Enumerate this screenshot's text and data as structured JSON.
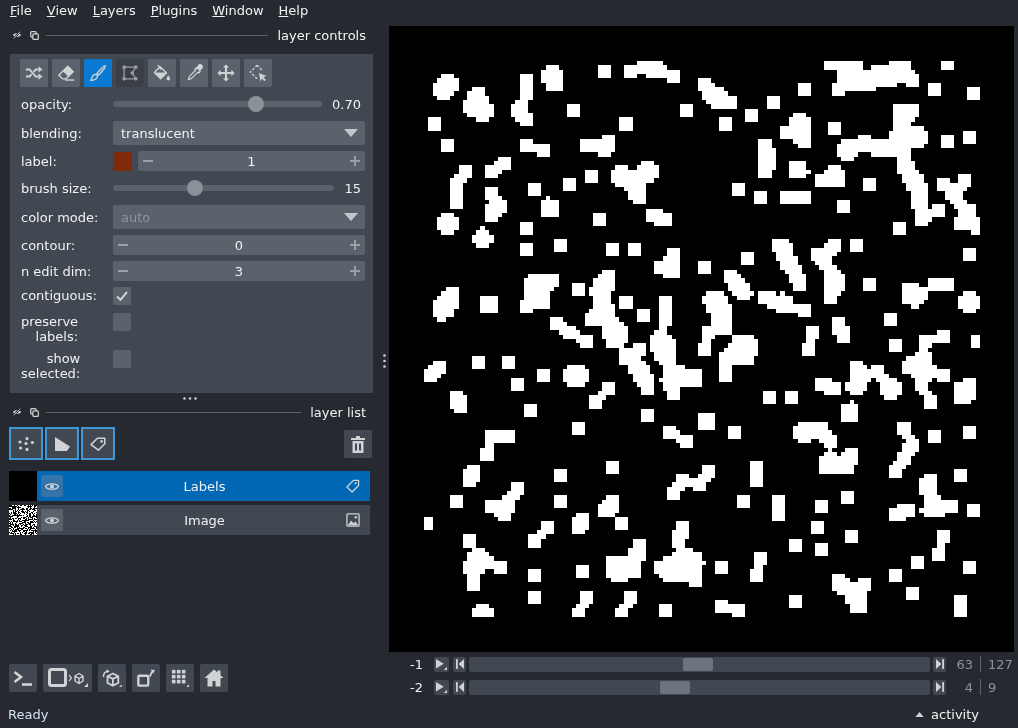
{
  "menu_bar": [
    "File",
    "View",
    "Layers",
    "Plugins",
    "Window",
    "Help"
  ],
  "layer_controls": {
    "title": "layer controls",
    "tools": [
      {
        "kind": "shuffle",
        "selected": false,
        "disabled": false
      },
      {
        "kind": "erase",
        "selected": false,
        "disabled": false
      },
      {
        "kind": "paint",
        "selected": true,
        "disabled": false
      },
      {
        "kind": "polygon",
        "selected": false,
        "disabled": true
      },
      {
        "kind": "fill",
        "selected": false,
        "disabled": false
      },
      {
        "kind": "picker",
        "selected": false,
        "disabled": false
      },
      {
        "kind": "pan_zoom",
        "selected": false,
        "disabled": false
      },
      {
        "kind": "transform",
        "selected": false,
        "disabled": false
      }
    ],
    "rows": [
      {
        "kind": "slider",
        "label": "opacity:",
        "level": 0.7,
        "reading": "0.70"
      },
      {
        "kind": "dropdown",
        "label": "blending:",
        "value": "translucent",
        "disabled": false
      },
      {
        "kind": "spinbox",
        "label": "label:",
        "value": "1",
        "color": "#7f2a0a"
      },
      {
        "kind": "slider",
        "label": "brush size:",
        "level": 0.36,
        "reading": "15"
      },
      {
        "kind": "dropdown",
        "label": "color mode:",
        "value": "auto",
        "disabled": true
      },
      {
        "kind": "spinbox",
        "label": "contour:",
        "value": "0"
      },
      {
        "kind": "spinbox",
        "label": "n edit dim:",
        "value": "3"
      },
      {
        "kind": "checkbox",
        "label": "contiguous:",
        "checked": true
      },
      {
        "kind": "checkbox",
        "label": "preserve labels:",
        "checked": false
      },
      {
        "kind": "checkbox",
        "label": "show selected:",
        "checked": false
      }
    ]
  },
  "layer_list": {
    "title": "layer list",
    "layers": [
      {
        "kind": "labels",
        "name": "Labels",
        "selected": true,
        "visible": true
      },
      {
        "kind": "image",
        "name": "Image",
        "selected": false,
        "visible": true
      }
    ]
  },
  "dims": [
    {
      "label": "-1",
      "level": 0.496,
      "current": "63",
      "total": "127"
    },
    {
      "label": "-2",
      "level": 0.444,
      "current": "4",
      "total": "9"
    }
  ],
  "status_bar": {
    "message": "Ready",
    "activity": "activity"
  }
}
